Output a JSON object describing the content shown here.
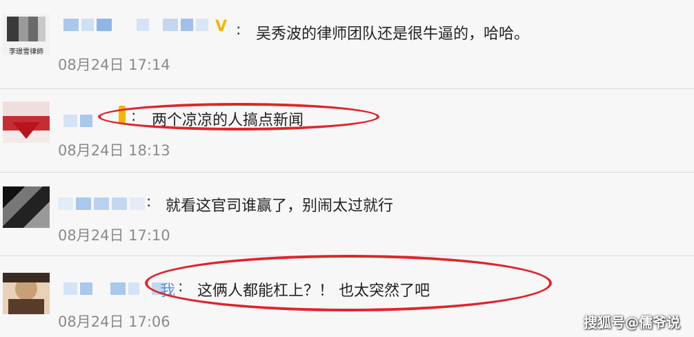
{
  "comments": [
    {
      "message": "吴秀波的律师团队还是很牛逼的，哈哈。",
      "time": "08月24日 17:14",
      "avatar_text": "李璟雪律師",
      "colon": ":"
    },
    {
      "message": "两个凉凉的人搞点新闻",
      "time": "08月24日 18:13",
      "colon": ":"
    },
    {
      "message": "就看这官司谁赢了，别闹太过就行",
      "time": "08月24日 17:10",
      "colon": ":"
    },
    {
      "message": "这俩人都能杠上？！ 也太突然了吧",
      "time": "08月24日 17:06",
      "colon": ":",
      "nick_tail": "我"
    }
  ],
  "watermark": "搜狐号@儒爷说",
  "colors": {
    "highlight": "#e0242b",
    "nick_blur": "#a9c8ec",
    "vip_badge": "#f5b400"
  }
}
